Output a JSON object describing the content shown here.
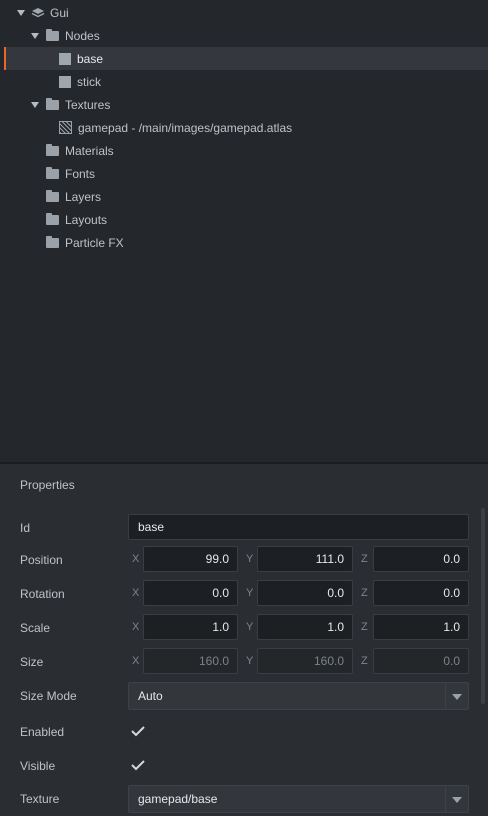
{
  "outline": {
    "root": "Gui",
    "nodes_label": "Nodes",
    "nodes": [
      "base",
      "stick"
    ],
    "selected_node": "base",
    "textures_label": "Textures",
    "textures": [
      "gamepad - /main/images/gamepad.atlas"
    ],
    "materials_label": "Materials",
    "fonts_label": "Fonts",
    "layers_label": "Layers",
    "layouts_label": "Layouts",
    "particlefx_label": "Particle FX"
  },
  "properties": {
    "title": "Properties",
    "id": {
      "label": "Id",
      "value": "base"
    },
    "position": {
      "label": "Position",
      "x": "99.0",
      "y": "111.0",
      "z": "0.0"
    },
    "rotation": {
      "label": "Rotation",
      "x": "0.0",
      "y": "0.0",
      "z": "0.0"
    },
    "scale": {
      "label": "Scale",
      "x": "1.0",
      "y": "1.0",
      "z": "1.0"
    },
    "size": {
      "label": "Size",
      "x": "160.0",
      "y": "160.0",
      "z": "0.0"
    },
    "size_mode": {
      "label": "Size Mode",
      "value": "Auto"
    },
    "enabled": {
      "label": "Enabled",
      "checked": true
    },
    "visible": {
      "label": "Visible",
      "checked": true
    },
    "texture": {
      "label": "Texture",
      "value": "gamepad/base"
    },
    "axis": {
      "x": "X",
      "y": "Y",
      "z": "Z"
    }
  },
  "colors": {
    "selection_accent": "#e8682a",
    "panel_bg": "#24272b",
    "properties_bg": "#2a2d32"
  },
  "icons": {
    "expanded": "chevron-down-icon",
    "folder": "folder-icon",
    "box_node": "box-node-icon",
    "atlas": "atlas-icon",
    "gui": "gui-layers-icon",
    "checkbox": "checkmark-icon"
  }
}
